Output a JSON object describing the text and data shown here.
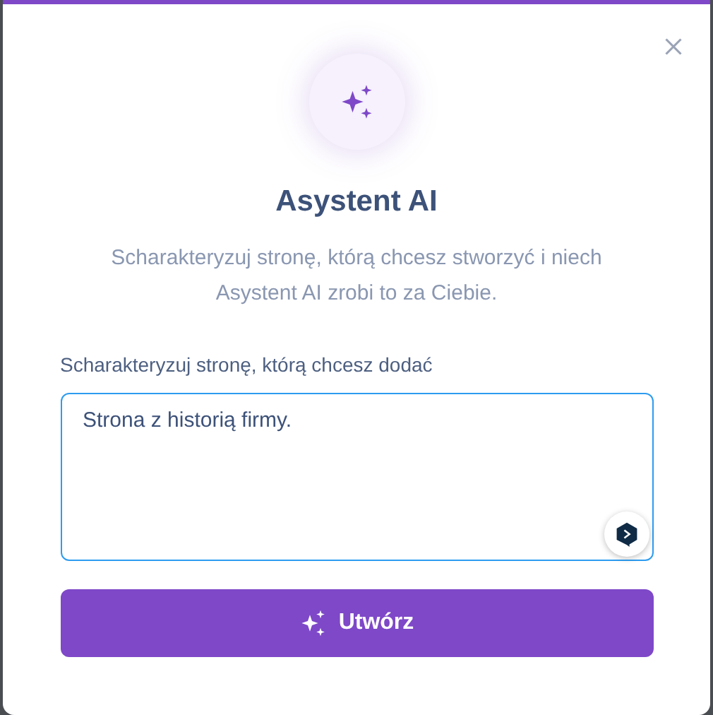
{
  "dialog": {
    "title": "Asystent AI",
    "description": "Scharakteryzuj stronę, którą chcesz stworzyć i niech Asystent AI zrobi to za Ciebie."
  },
  "field": {
    "label": "Scharakteryzuj stronę, którą chcesz dodać",
    "value": "Strona z historią firmy."
  },
  "button": {
    "label": "Utwórz"
  }
}
